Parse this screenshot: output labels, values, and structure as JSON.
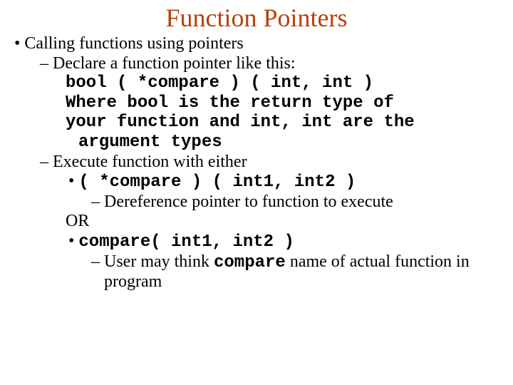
{
  "title": "Function Pointers",
  "b1": "Calling functions using pointers",
  "b1a": "Declare a function pointer like this:",
  "code1": "bool ( *compare ) ( int, int )",
  "code2a": "Where bool is the return type of",
  "code2b": "your function and int, int are the argument types",
  "b1b": "Execute function with either",
  "call1": "( *compare ) ( int1, int2 )",
  "note1": "Dereference pointer to function to execute",
  "or": "OR",
  "call2": "compare( int1, int2 )",
  "note2a": "User may think ",
  "note2b": "compare",
  "note2c": " name of actual function in program"
}
